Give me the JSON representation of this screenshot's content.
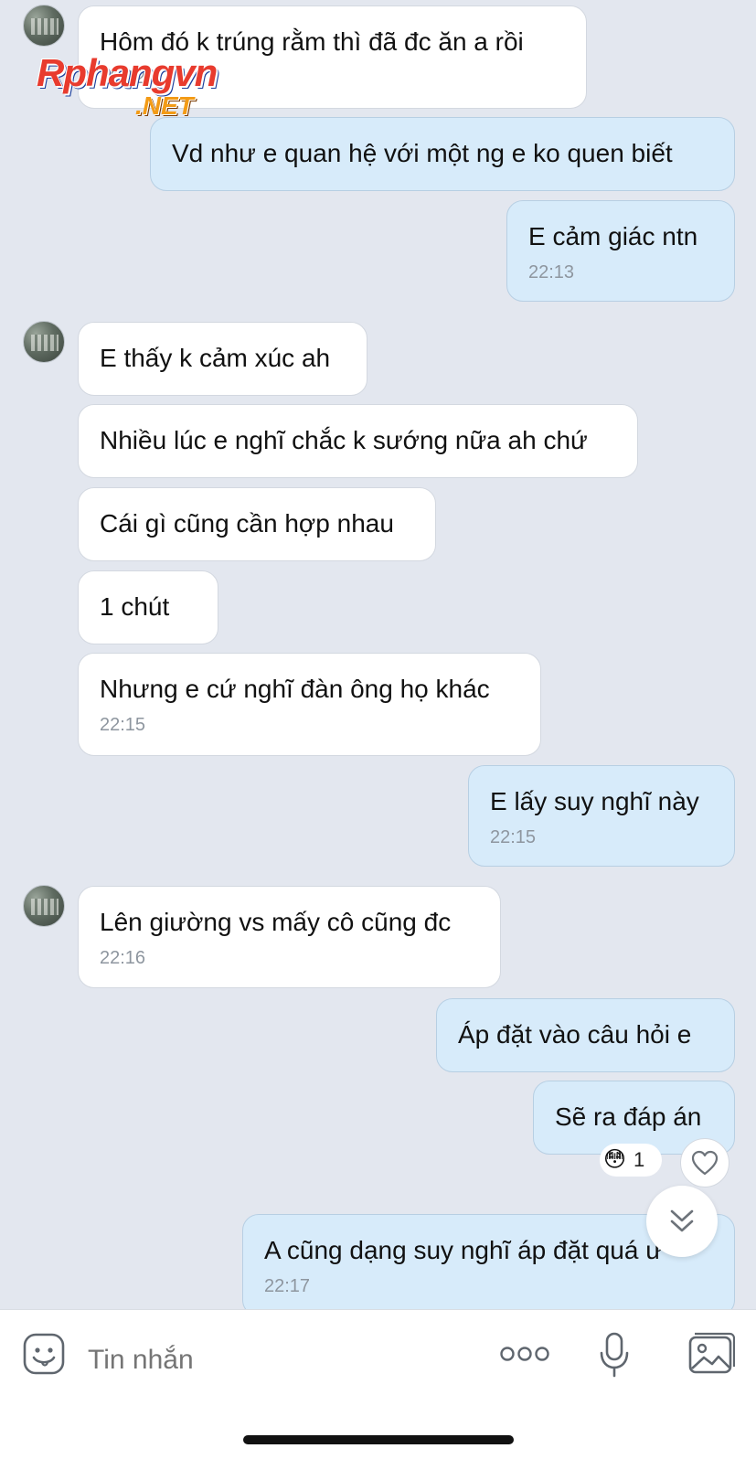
{
  "messages": [
    {
      "side": "in",
      "text": "Hôm đó k trúng rằm thì đã đc ăn a rồi",
      "time": "22:12"
    },
    {
      "side": "out",
      "text": "Vd như e quan hệ với một ng e ko quen biết",
      "time": ""
    },
    {
      "side": "out",
      "text": "E cảm giác ntn",
      "time": "22:13"
    },
    {
      "side": "in",
      "text": "E thấy k cảm xúc ah",
      "time": ""
    },
    {
      "side": "in",
      "text": "Nhiều lúc e nghĩ chắc k sướng nữa ah chứ",
      "time": ""
    },
    {
      "side": "in",
      "text": "Cái gì cũng cần hợp nhau",
      "time": ""
    },
    {
      "side": "in",
      "text": "1 chút",
      "time": ""
    },
    {
      "side": "in",
      "text": "Nhưng e cứ nghĩ đàn ông họ khác",
      "time": "22:15"
    },
    {
      "side": "out",
      "text": "E lấy suy nghĩ này",
      "time": "22:15"
    },
    {
      "side": "in",
      "text": "Lên giường vs mấy cô cũng đc",
      "time": "22:16"
    },
    {
      "side": "out",
      "text": "Áp đặt vào câu hỏi e",
      "time": ""
    },
    {
      "side": "out",
      "text": "Sẽ ra đáp án",
      "time": ""
    },
    {
      "side": "out",
      "text": "A cũng dạng suy nghĩ áp đặt quá ư",
      "time": "22:17"
    }
  ],
  "reaction": {
    "emoji": "😳",
    "count": "1"
  },
  "watermark": {
    "main": "Rphangvn",
    "sub": ".NET"
  },
  "input": {
    "placeholder": "Tin nhắn"
  },
  "icons": {
    "sticker": "sticker-smiley-icon",
    "more": "more-dots-icon",
    "mic": "microphone-icon",
    "image": "image-gallery-icon",
    "heart": "heart-icon",
    "scroll": "double-chevron-down-icon"
  },
  "colors": {
    "background": "#e3e7ef",
    "incoming_bubble": "#ffffff",
    "outgoing_bubble": "#d7ebfa",
    "timestamp": "#8e969f"
  }
}
